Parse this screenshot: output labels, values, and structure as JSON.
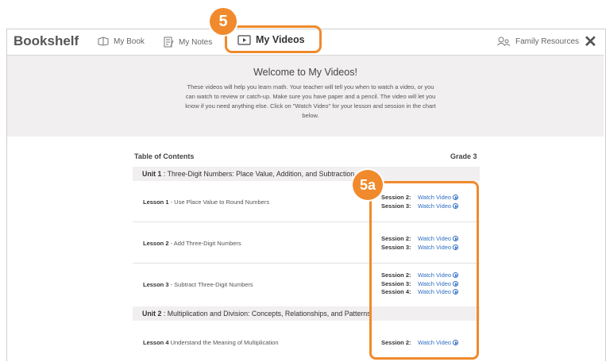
{
  "header": {
    "brand": "Bookshelf",
    "nav": [
      {
        "label": "My Book"
      },
      {
        "label": "My Notes"
      },
      {
        "label": "My Videos"
      },
      {
        "label": "Family Resources"
      }
    ],
    "close_label": "✕"
  },
  "callouts": {
    "tab_badge": "5",
    "sessions_badge": "5a"
  },
  "welcome": {
    "title": "Welcome to My Videos!",
    "text": "These videos will help you learn math. Your teacher will tell you when to watch a video, or you can watch to review or catch-up. Make sure you have paper and a pencil. The video will let you know if you need anything else. Click on \"Watch Video\" for your lesson and session in the chart below."
  },
  "toc": {
    "title": "Table of Contents",
    "grade": "Grade 3",
    "units": [
      {
        "label": "Unit 1",
        "title": " : Three-Digit Numbers: Place Value, Addition, and Subtraction"
      },
      {
        "label": "Unit 2",
        "title": " : Multiplication and Division: Concepts, Relationships, and Patterns"
      }
    ],
    "lessons": [
      {
        "label": "Lesson 1",
        "title": " - Use Place Value to Round Numbers",
        "sessions": [
          {
            "label": "Session 2:",
            "link": "Watch Video"
          },
          {
            "label": "Session 3:",
            "link": "Watch Video"
          }
        ]
      },
      {
        "label": "Lesson 2",
        "title": " - Add Three-Digit Numbers",
        "sessions": [
          {
            "label": "Session 2:",
            "link": "Watch Video"
          },
          {
            "label": "Session 3:",
            "link": "Watch Video"
          }
        ]
      },
      {
        "label": "Lesson 3",
        "title": " - Subtract Three-Digit Numbers",
        "sessions": [
          {
            "label": "Session 2:",
            "link": "Watch Video"
          },
          {
            "label": "Session 3:",
            "link": "Watch Video"
          },
          {
            "label": "Session 4:",
            "link": "Watch Video"
          }
        ]
      },
      {
        "label": "Lesson 4",
        "title": "  Understand the Meaning of Multiplication",
        "sessions": [
          {
            "label": "Session 2:",
            "link": "Watch Video"
          }
        ]
      }
    ]
  },
  "colors": {
    "accent": "#f08a2c",
    "link": "#2f6fc4",
    "panel": "#f2eff0"
  }
}
